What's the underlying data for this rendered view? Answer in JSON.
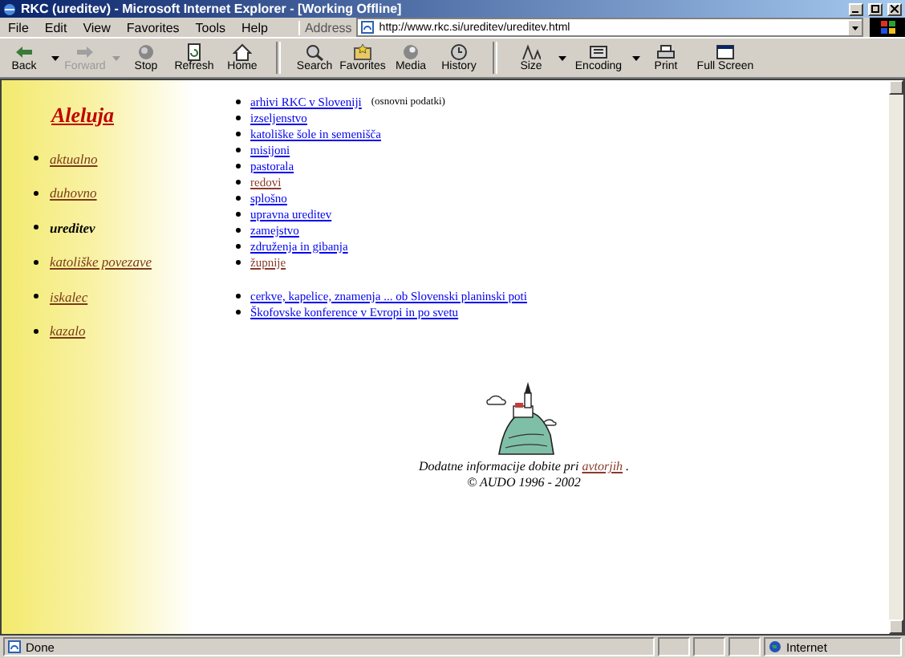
{
  "window": {
    "title": "RKC (ureditev) - Microsoft Internet Explorer - [Working Offline]"
  },
  "menu": [
    "File",
    "Edit",
    "View",
    "Favorites",
    "Tools",
    "Help"
  ],
  "address": {
    "label": "Address",
    "value": "http://www.rkc.si/ureditev/ureditev.html"
  },
  "toolbar": [
    {
      "label": "Back",
      "kind": "back",
      "disabled": false,
      "dropdown": true
    },
    {
      "label": "Forward",
      "kind": "forward",
      "disabled": true,
      "dropdown": true
    },
    {
      "label": "Stop",
      "kind": "stop",
      "disabled": false,
      "dropdown": false
    },
    {
      "label": "Refresh",
      "kind": "refresh",
      "disabled": false,
      "dropdown": false
    },
    {
      "label": "Home",
      "kind": "home",
      "disabled": false,
      "dropdown": false
    },
    {
      "label": "Search",
      "kind": "search",
      "disabled": false,
      "dropdown": false
    },
    {
      "label": "Favorites",
      "kind": "favorites",
      "disabled": false,
      "dropdown": false
    },
    {
      "label": "Media",
      "kind": "media",
      "disabled": false,
      "dropdown": false
    },
    {
      "label": "History",
      "kind": "history",
      "disabled": false,
      "dropdown": false
    },
    {
      "label": "Size",
      "kind": "size",
      "disabled": false,
      "dropdown": true
    },
    {
      "label": "Encoding",
      "kind": "encoding",
      "disabled": false,
      "dropdown": true
    },
    {
      "label": "Print",
      "kind": "print",
      "disabled": false,
      "dropdown": false
    },
    {
      "label": "Full Screen",
      "kind": "fullscreen",
      "disabled": false,
      "dropdown": false
    }
  ],
  "sidebar": {
    "title": "Aleluja",
    "items": [
      {
        "label": "aktualno",
        "selected": false
      },
      {
        "label": "duhovno",
        "selected": false
      },
      {
        "label": "ureditev",
        "selected": true
      },
      {
        "label": "katoliške povezave",
        "selected": false
      },
      {
        "label": "iskalec",
        "selected": false
      },
      {
        "label": "kazalo",
        "selected": false
      }
    ]
  },
  "links": [
    {
      "label": "arhivi RKC v Sloveniji ",
      "note": "(osnovni podatki)",
      "visited": false
    },
    {
      "label": "izseljenstvo",
      "visited": false
    },
    {
      "label": "katoliške šole in semenišča",
      "visited": false
    },
    {
      "label": "misijoni",
      "visited": false
    },
    {
      "label": "pastorala",
      "visited": false
    },
    {
      "label": "redovi",
      "visited": true
    },
    {
      "label": "splošno",
      "visited": false
    },
    {
      "label": "upravna ureditev",
      "visited": false
    },
    {
      "label": "zamejstvo",
      "visited": false
    },
    {
      "label": "združenja in gibanja",
      "visited": false
    },
    {
      "label": "župnije",
      "visited": true
    }
  ],
  "links_2": [
    {
      "label": "cerkve, kapelice, znamenja ... ob Slovenski planinski poti",
      "visited": false
    },
    {
      "label": "Škofovske konference v Evropi in po svetu",
      "visited": false
    }
  ],
  "footer": {
    "text": "Dodatne informacije dobite pri ",
    "link": "avtorjih",
    "after": " .",
    "copyright": "© AUDO 1996 - 2002"
  },
  "status_bar": {
    "text": "Done",
    "zone": "Internet"
  }
}
